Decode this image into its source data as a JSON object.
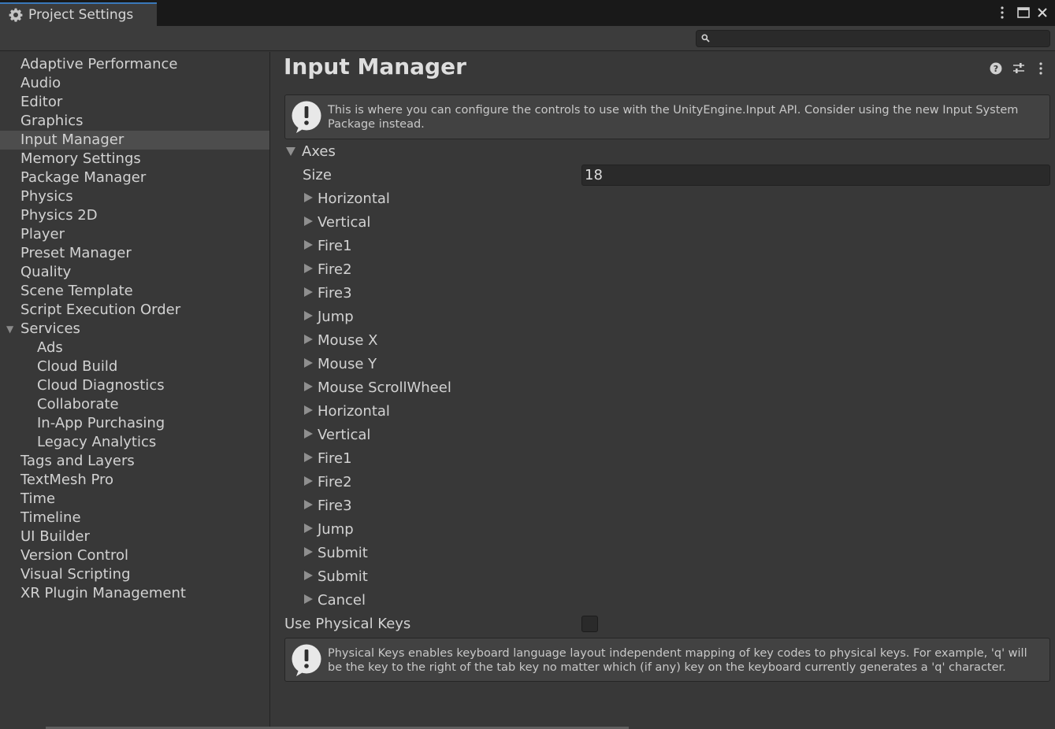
{
  "window": {
    "tab_title": "Project Settings"
  },
  "search": {
    "placeholder": "",
    "value": ""
  },
  "sidebar": {
    "items": [
      {
        "label": "Adaptive Performance",
        "indent": 0
      },
      {
        "label": "Audio",
        "indent": 0
      },
      {
        "label": "Editor",
        "indent": 0
      },
      {
        "label": "Graphics",
        "indent": 0
      },
      {
        "label": "Input Manager",
        "indent": 0,
        "selected": true
      },
      {
        "label": "Memory Settings",
        "indent": 0
      },
      {
        "label": "Package Manager",
        "indent": 0
      },
      {
        "label": "Physics",
        "indent": 0
      },
      {
        "label": "Physics 2D",
        "indent": 0
      },
      {
        "label": "Player",
        "indent": 0
      },
      {
        "label": "Preset Manager",
        "indent": 0
      },
      {
        "label": "Quality",
        "indent": 0
      },
      {
        "label": "Scene Template",
        "indent": 0
      },
      {
        "label": "Script Execution Order",
        "indent": 0
      },
      {
        "label": "Services",
        "indent": 0,
        "expanded": true
      },
      {
        "label": "Ads",
        "indent": 1
      },
      {
        "label": "Cloud Build",
        "indent": 1
      },
      {
        "label": "Cloud Diagnostics",
        "indent": 1
      },
      {
        "label": "Collaborate",
        "indent": 1
      },
      {
        "label": "In-App Purchasing",
        "indent": 1
      },
      {
        "label": "Legacy Analytics",
        "indent": 1
      },
      {
        "label": "Tags and Layers",
        "indent": 0
      },
      {
        "label": "TextMesh Pro",
        "indent": 0
      },
      {
        "label": "Time",
        "indent": 0
      },
      {
        "label": "Timeline",
        "indent": 0
      },
      {
        "label": "UI Builder",
        "indent": 0
      },
      {
        "label": "Version Control",
        "indent": 0
      },
      {
        "label": "Visual Scripting",
        "indent": 0
      },
      {
        "label": "XR Plugin Management",
        "indent": 0
      }
    ]
  },
  "main": {
    "title": "Input Manager",
    "info_text": "This is where you can configure the controls to use with the UnityEngine.Input API. Consider using the new Input System Package instead.",
    "axes_label": "Axes",
    "size_label": "Size",
    "size_value": "18",
    "axes": [
      "Horizontal",
      "Vertical",
      "Fire1",
      "Fire2",
      "Fire3",
      "Jump",
      "Mouse X",
      "Mouse Y",
      "Mouse ScrollWheel",
      "Horizontal",
      "Vertical",
      "Fire1",
      "Fire2",
      "Fire3",
      "Jump",
      "Submit",
      "Submit",
      "Cancel"
    ],
    "physical_keys_label": "Use Physical Keys",
    "physical_keys_checked": false,
    "physical_keys_text": "Physical Keys enables keyboard language layout independent mapping of key codes to physical keys. For example, 'q' will be the key to the right of the tab key no matter which (if any) key on the keyboard currently generates a 'q' character."
  },
  "icons": {
    "tab": "gear-icon",
    "window_menu": "kebab-icon",
    "maximize": "maximize-icon",
    "close": "close-icon",
    "search": "search-icon",
    "help": "help-icon",
    "presets": "sliders-icon",
    "more": "kebab-icon",
    "warning": "warning-icon"
  },
  "colors": {
    "background": "#383838",
    "titlebar": "#191919",
    "selected_row": "#4d4d4d",
    "tab_accent": "#3a79bb"
  }
}
